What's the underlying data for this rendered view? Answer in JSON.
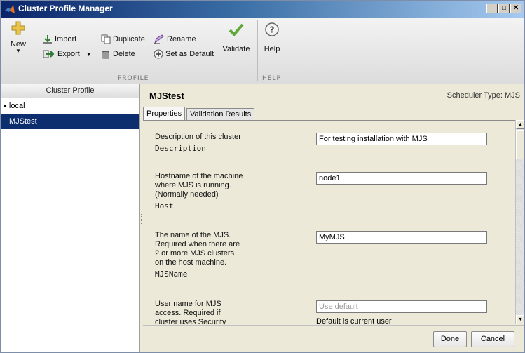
{
  "window": {
    "title": "Cluster Profile Manager",
    "controls": [
      "_",
      "□",
      "✕"
    ]
  },
  "toolstrip": {
    "new_label": "New",
    "import_label": "Import",
    "export_label": "Export",
    "duplicate_label": "Duplicate",
    "delete_label": "Delete",
    "rename_label": "Rename",
    "set_default_label": "Set as Default",
    "validate_label": "Validate",
    "help_label": "Help",
    "section_profile": "PROFILE",
    "section_help": "HELP",
    "colors": {
      "accent": "#0c2e6e",
      "validate_check": "#5fa83a",
      "new_plus": "#e8c44a"
    }
  },
  "sidebar": {
    "header": "Cluster Profile",
    "items": [
      {
        "label": "local",
        "marker": "●"
      },
      {
        "label": "MJStest"
      }
    ]
  },
  "main": {
    "profile_name": "MJStest",
    "scheduler_type": "Scheduler Type: MJS",
    "tabs": [
      {
        "label": "Properties"
      },
      {
        "label": "Validation Results"
      }
    ],
    "properties": [
      {
        "desc_lines": [
          "Description of this cluster"
        ],
        "prop": "Description",
        "value": "For testing installation with MJS"
      },
      {
        "desc_lines": [
          "Hostname of the machine",
          "where MJS is running.",
          "(Normally needed)"
        ],
        "prop": "Host",
        "value": "node1"
      },
      {
        "desc_lines": [
          "The name of the MJS.",
          "Required when there are",
          "2 or more MJS clusters",
          "on the host machine."
        ],
        "prop": "MJSName",
        "value": "MyMJS"
      },
      {
        "desc_lines": [
          "User name for MJS",
          "access. Required if",
          "cluster uses Security"
        ],
        "prop": "",
        "placeholder": "Use default",
        "note": "Default is current user"
      }
    ],
    "done_label": "Done",
    "cancel_label": "Cancel"
  }
}
